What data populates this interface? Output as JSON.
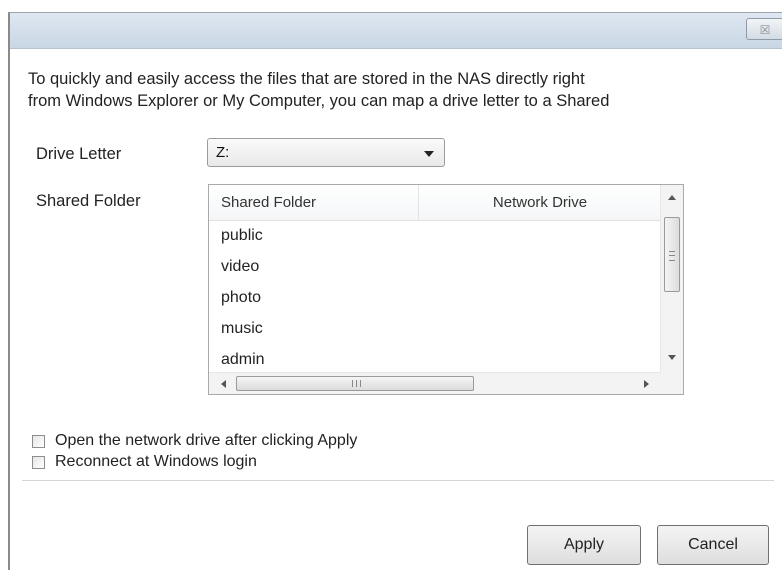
{
  "dialog": {
    "close_glyph": "☒",
    "intro_line1": "To quickly and easily access the files that are stored in the NAS directly right",
    "intro_line2": "from Windows Explorer or My Computer, you can map a drive letter to a Shared"
  },
  "drive_letter": {
    "label": "Drive Letter",
    "selected": "Z:"
  },
  "shared_folder": {
    "label": "Shared Folder",
    "columns": [
      "Shared Folder",
      "Network Drive"
    ],
    "rows": [
      "public",
      "video",
      "photo",
      "music",
      "admin"
    ]
  },
  "options": {
    "open_after_apply": {
      "label": "Open the network drive after clicking Apply",
      "checked": false
    },
    "reconnect": {
      "label": "Reconnect at Windows login",
      "checked": false
    }
  },
  "buttons": {
    "apply": "Apply",
    "cancel": "Cancel"
  }
}
